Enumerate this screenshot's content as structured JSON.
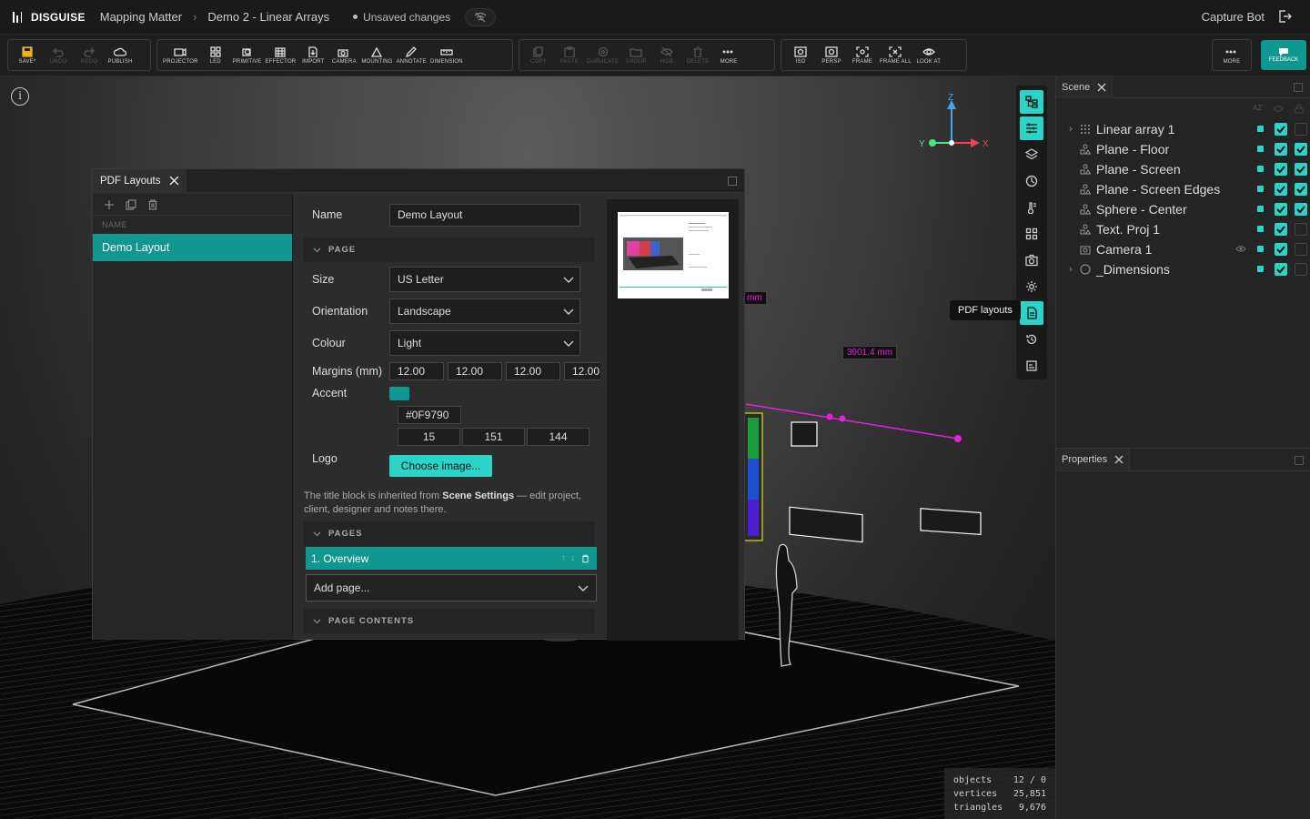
{
  "topbar": {
    "brand": "DISGUISE",
    "crumbs": [
      "Mapping Matter",
      "Demo 2 - Linear Arrays"
    ],
    "unsaved": "Unsaved changes",
    "user": "Capture Bot"
  },
  "toolbar": {
    "groups": [
      [
        {
          "label": "SAVE*",
          "icon": "save-icon",
          "enabled": true
        },
        {
          "label": "UNDO",
          "icon": "undo-icon",
          "enabled": false
        },
        {
          "label": "REDO",
          "icon": "redo-icon",
          "enabled": false
        },
        {
          "label": "PUBLISH",
          "icon": "cloud-icon",
          "enabled": true
        }
      ],
      [
        {
          "label": "PROJECTOR",
          "icon": "projector-icon",
          "enabled": true
        },
        {
          "label": "LED",
          "icon": "led-icon",
          "enabled": true
        },
        {
          "label": "PRIMITIVE",
          "icon": "primitive-icon",
          "enabled": true
        },
        {
          "label": "EFFECTOR",
          "icon": "effector-icon",
          "enabled": true
        },
        {
          "label": "IMPORT",
          "icon": "import-icon",
          "enabled": true
        },
        {
          "label": "CAMERA",
          "icon": "camera-icon",
          "enabled": true
        },
        {
          "label": "MOUNTING",
          "icon": "mounting-icon",
          "enabled": true
        },
        {
          "label": "ANNOTATE",
          "icon": "annotate-icon",
          "enabled": true
        },
        {
          "label": "DIMENSION",
          "icon": "dimension-icon",
          "enabled": true
        }
      ],
      [
        {
          "label": "COPY",
          "icon": "copy-icon",
          "enabled": false
        },
        {
          "label": "PASTE",
          "icon": "paste-icon",
          "enabled": false
        },
        {
          "label": "DUPLICATE",
          "icon": "duplicate-icon",
          "enabled": false
        },
        {
          "label": "GROUP",
          "icon": "group-icon",
          "enabled": false
        },
        {
          "label": "HIDE",
          "icon": "hide-icon",
          "enabled": false
        },
        {
          "label": "DELETE",
          "icon": "delete-icon",
          "enabled": false
        },
        {
          "label": "MORE",
          "icon": "more-icon",
          "enabled": true
        }
      ],
      [
        {
          "label": "ISO",
          "icon": "iso-icon",
          "enabled": true
        },
        {
          "label": "PERSP",
          "icon": "persp-icon",
          "enabled": true
        },
        {
          "label": "FRAME",
          "icon": "frame-icon",
          "enabled": true
        },
        {
          "label": "FRAME ALL",
          "icon": "frame-all-icon",
          "enabled": true
        },
        {
          "label": "LOOK AT",
          "icon": "look-at-icon",
          "enabled": true
        }
      ],
      [
        {
          "label": "MORE",
          "icon": "more-icon",
          "enabled": true
        }
      ]
    ],
    "feedback": "FEEDBACK"
  },
  "viewport": {
    "axes": {
      "z": "Z",
      "y": "Y",
      "x": "X"
    },
    "dim_label_1": "mm",
    "dim_label_2": "3901.4 mm",
    "stats": [
      {
        "label": "objects",
        "value": "12 / 0"
      },
      {
        "label": "vertices",
        "value": "25,851"
      },
      {
        "label": "triangles",
        "value": "9,676"
      }
    ],
    "tooltip": "PDF layouts"
  },
  "scene": {
    "tab": "Scene",
    "sort_label": "AZ",
    "items": [
      {
        "name": "Linear array 1",
        "expandable": true,
        "icon": "grid-icon",
        "vis": true,
        "lock": false
      },
      {
        "name": "Plane - Floor",
        "expandable": false,
        "icon": "shapes-icon",
        "vis": true,
        "lock": true
      },
      {
        "name": "Plane - Screen",
        "expandable": false,
        "icon": "shapes-icon",
        "vis": true,
        "lock": true
      },
      {
        "name": "Plane - Screen Edges",
        "expandable": false,
        "icon": "shapes-icon",
        "vis": true,
        "lock": true
      },
      {
        "name": "Sphere - Center",
        "expandable": false,
        "icon": "shapes-icon",
        "vis": true,
        "lock": true
      },
      {
        "name": "Text. Proj 1",
        "expandable": false,
        "icon": "shapes-icon",
        "vis": true,
        "lock": false
      },
      {
        "name": "Camera 1",
        "expandable": false,
        "icon": "camera-icon",
        "vis": true,
        "lock": false
      },
      {
        "name": "_Dimensions",
        "expandable": true,
        "icon": "circle-icon",
        "vis": true,
        "lock": false
      }
    ]
  },
  "properties": {
    "tab": "Properties"
  },
  "pdf": {
    "tab": "PDF Layouts",
    "list_header": "NAME",
    "layouts": [
      "Demo Layout"
    ],
    "name_label": "Name",
    "name_value": "Demo Layout",
    "page_section": "PAGE",
    "size_label": "Size",
    "size_value": "US Letter",
    "orientation_label": "Orientation",
    "orientation_value": "Landscape",
    "colour_label": "Colour",
    "colour_value": "Light",
    "margins_label": "Margins (mm)",
    "margins": [
      "12.00",
      "12.00",
      "12.00",
      "12.00"
    ],
    "accent_label": "Accent",
    "accent_color": "#0F9790",
    "accent_hex": "#0F9790",
    "accent_rgb": [
      "15",
      "151",
      "144"
    ],
    "logo_label": "Logo",
    "logo_button": "Choose image...",
    "note_pre": "The title block is inherited from ",
    "note_bold": "Scene Settings",
    "note_post": " — edit project, client, designer and notes there.",
    "pages_section": "PAGES",
    "page_item": "1. Overview",
    "add_page": "Add page...",
    "contents_section": "PAGE CONTENTS"
  }
}
